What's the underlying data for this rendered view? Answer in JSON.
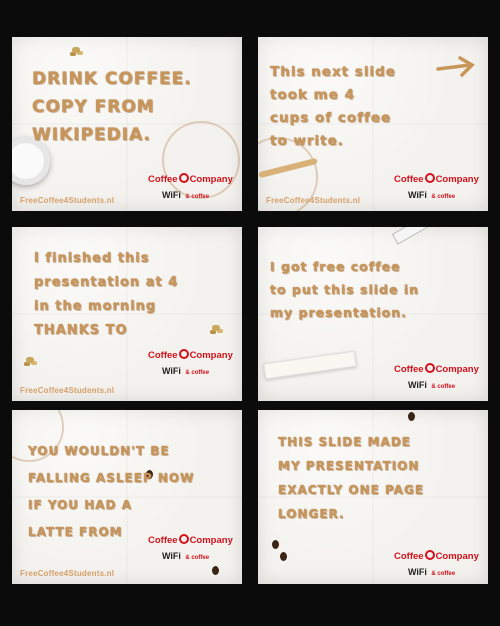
{
  "footer_url": "FreeCoffee4Students.nl",
  "logo": {
    "brand_a": "Coffee",
    "brand_b": "Company",
    "wifi": "WiFi",
    "amp": "& coffee"
  },
  "panels": [
    {
      "id": "p1",
      "text": "DRINK COFFEE.\nCOPY FROM\nWIKIPEDIA."
    },
    {
      "id": "p2",
      "text": "This next slide\ntook me 4\ncups of coffee\nto write."
    },
    {
      "id": "p3",
      "text": "I finished this\npresentation at 4\nin the morning\nTHANKS TO"
    },
    {
      "id": "p4",
      "text": "I got free coffee\nto put this slide in\nmy presentation."
    },
    {
      "id": "p5",
      "text": "YOU WOULDN'T BE\nFALLING ASLEEP NOW\nIF YOU HAD A\nLATTE FROM"
    },
    {
      "id": "p6",
      "text": "THIS SLIDE MADE\nMY PRESENTATION\nEXACTLY ONE PAGE\nLONGER."
    }
  ],
  "colors": {
    "coffee": "#c8955a",
    "brand_red": "#d3111c",
    "background": "#0b0b0b",
    "napkin": "#f3f2ee"
  }
}
